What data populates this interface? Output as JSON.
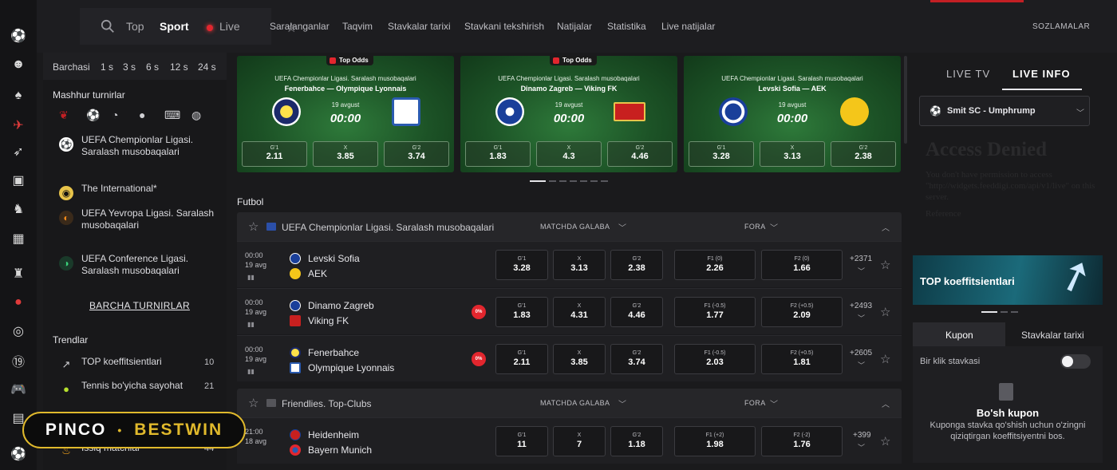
{
  "search_tabs": {
    "top": "Top",
    "sport": "Sport",
    "live": "Live"
  },
  "nav": [
    "Saralanganlar",
    "Taqvim",
    "Stavkalar tarixi",
    "Stavkani tekshirish",
    "Natijalar",
    "Statistika",
    "Live natijalar"
  ],
  "settings": "SOZLAMALAR",
  "time_filters": [
    "Barchasi",
    "1 s",
    "3 s",
    "6 s",
    "12 s",
    "24 s"
  ],
  "sidebar": {
    "popular_title": "Mashhur turnirlar",
    "tournaments": [
      {
        "name": "UEFA Chempionlar Ligasi. Saralash musobaqalari",
        "icon": "ball-icon"
      },
      {
        "name": "The International*",
        "icon": "dota-icon"
      },
      {
        "name": "UEFA Yevropa Ligasi. Saralash musobaqalari",
        "icon": "europa-icon"
      },
      {
        "name": "UEFA Conference Ligasi. Saralash musobaqalari",
        "icon": "conference-icon"
      }
    ],
    "all_tournaments": "BARCHA TURNIRLAR",
    "trends_title": "Trendlar",
    "trends": [
      {
        "name": "TOP koeffitsientlari",
        "count": "10",
        "icon": "trend-up-icon"
      },
      {
        "name": "Tennis bo'yicha sayohat",
        "count": "21",
        "icon": "tennis-icon"
      },
      {
        "name": "Issiq matchlar",
        "count": "44",
        "icon": "fire-icon"
      }
    ]
  },
  "banner": {
    "left": "PINCO",
    "sep": "•",
    "right": "BESTWIN"
  },
  "featured": [
    {
      "tag": "Top Odds",
      "league": "UEFA Chempionlar Ligasi. Saralash musobaqalari",
      "home": "Fenerbahce",
      "away": "Olympique Lyonnais",
      "date": "19 avgust",
      "time": "00:00",
      "odds": [
        {
          "l": "G'1",
          "v": "2.11"
        },
        {
          "l": "X",
          "v": "3.85"
        },
        {
          "l": "G'2",
          "v": "3.74"
        }
      ]
    },
    {
      "tag": "Top Odds",
      "league": "UEFA Chempionlar Ligasi. Saralash musobaqalari",
      "home": "Dinamo Zagreb",
      "away": "Viking FK",
      "date": "19 avgust",
      "time": "00:00",
      "odds": [
        {
          "l": "G'1",
          "v": "1.83"
        },
        {
          "l": "X",
          "v": "4.3"
        },
        {
          "l": "G'2",
          "v": "4.46"
        }
      ]
    },
    {
      "tag": "",
      "league": "UEFA Chempionlar Ligasi. Saralash musobaqalari",
      "home": "Levski Sofia",
      "away": "AEK",
      "date": "19 avgust",
      "time": "00:00",
      "odds": [
        {
          "l": "G'1",
          "v": "3.28"
        },
        {
          "l": "X",
          "v": "3.13"
        },
        {
          "l": "G'2",
          "v": "2.38"
        }
      ]
    }
  ],
  "sections": {
    "title": "Futbol",
    "leagues": [
      {
        "name": "UEFA Chempionlar Ligasi. Saralash musobaqalari",
        "market1": "MATCHDA GALABA",
        "market2": "FORA",
        "matches": [
          {
            "time": "00:00",
            "date": "19 avg",
            "home": "Levski Sofia",
            "away": "AEK",
            "promo": "",
            "odds": [
              {
                "l": "G'1",
                "v": "3.28"
              },
              {
                "l": "X",
                "v": "3.13"
              },
              {
                "l": "G'2",
                "v": "2.38"
              },
              {
                "l": "F1 (0)",
                "v": "2.26"
              },
              {
                "l": "F2 (0)",
                "v": "1.66"
              }
            ],
            "more": "+2371"
          },
          {
            "time": "00:00",
            "date": "19 avg",
            "home": "Dinamo Zagreb",
            "away": "Viking FK",
            "promo": "0%",
            "odds": [
              {
                "l": "G'1",
                "v": "1.83"
              },
              {
                "l": "X",
                "v": "4.31"
              },
              {
                "l": "G'2",
                "v": "4.46"
              },
              {
                "l": "F1 (-0.5)",
                "v": "1.77"
              },
              {
                "l": "F2 (+0.5)",
                "v": "2.09"
              }
            ],
            "more": "+2493"
          },
          {
            "time": "00:00",
            "date": "19 avg",
            "home": "Fenerbahce",
            "away": "Olympique Lyonnais",
            "promo": "0%",
            "odds": [
              {
                "l": "G'1",
                "v": "2.11"
              },
              {
                "l": "X",
                "v": "3.85"
              },
              {
                "l": "G'2",
                "v": "3.74"
              },
              {
                "l": "F1 (-0.5)",
                "v": "2.03"
              },
              {
                "l": "F2 (+0.5)",
                "v": "1.81"
              }
            ],
            "more": "+2605"
          }
        ]
      },
      {
        "name": "Friendlies. Top-Clubs",
        "market1": "MATCHDA GALABA",
        "market2": "FORA",
        "matches": [
          {
            "time": "21:00",
            "date": "18 avg",
            "home": "Heidenheim",
            "away": "Bayern Munich",
            "promo": "",
            "odds": [
              {
                "l": "G'1",
                "v": "11"
              },
              {
                "l": "X",
                "v": "7"
              },
              {
                "l": "G'2",
                "v": "1.18"
              },
              {
                "l": "F1 (+2)",
                "v": "1.98"
              },
              {
                "l": "F2 (-2)",
                "v": "1.76"
              }
            ],
            "more": "+399"
          }
        ]
      }
    ]
  },
  "right": {
    "tabs": [
      "LIVE TV",
      "LIVE INFO"
    ],
    "match": "Smit SC - Umphrump",
    "denied_title": "Access Denied",
    "denied_text": "You don't have permission to access \"http://widgets.feeddigi.com/api/v1/live\" on this server.",
    "denied_ref": "Reference",
    "promo": "TOP koeffitsientlari",
    "coupon_tabs": [
      "Kupon",
      "Stavkalar tarixi"
    ],
    "one_click": "Bir klik stavkasi",
    "empty_title": "Bo'sh kupon",
    "empty_hint": "Kuponga stavka qo'shish uchun o'zingni qiziqtirgan koeffitsiyentni bos."
  }
}
